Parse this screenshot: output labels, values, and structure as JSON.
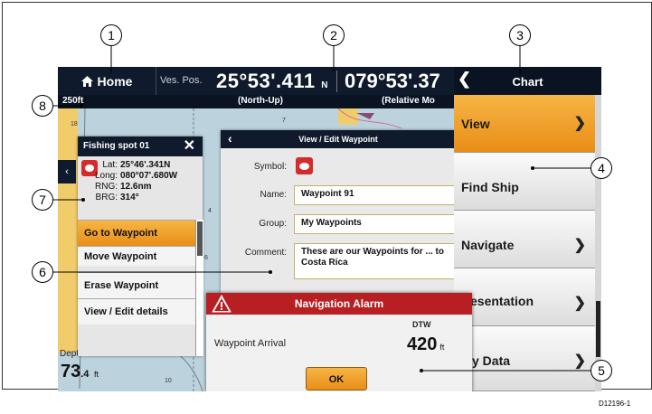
{
  "topbar": {
    "home_label": "Home",
    "vessel_pos_label": "Ves. Pos.",
    "latitude": "25°53'.411",
    "lat_hemisphere": "N",
    "longitude": "079°53'.37",
    "chart_label": "Chart"
  },
  "statusbar": {
    "range": "250ft",
    "orientation": "(North-Up)",
    "motion": "(Relative Mo"
  },
  "fishing_spot": {
    "title": "Fishing spot 01",
    "lat_label": "Lat:",
    "lat_value": "25°46'.341N",
    "long_label": "Long:",
    "long_value": "080°07'.680W",
    "rng_label": "RNG:",
    "rng_value": "12.6nm",
    "brg_label": "BRG:",
    "brg_value": "314°",
    "menu": [
      {
        "label": "Go to Waypoint"
      },
      {
        "label": "Move Waypoint"
      },
      {
        "label": "Erase Waypoint"
      },
      {
        "label": "View / Edit details"
      }
    ]
  },
  "depth": {
    "label": "Depth",
    "value_int": "73",
    "value_dec": ".4",
    "unit": "ft"
  },
  "waypoint_panel": {
    "title": "View / Edit Waypoint",
    "symbol_label": "Symbol:",
    "name_label": "Name:",
    "name_value": "Waypoint 91",
    "group_label": "Group:",
    "group_value": "My Waypoints",
    "comment_label": "Comment:",
    "comment_value": "These are our Waypoints for ... to Costa Rica"
  },
  "menu": {
    "items": [
      {
        "label": "View"
      },
      {
        "label": "Find Ship"
      },
      {
        "label": "Navigate"
      },
      {
        "label": "esentation"
      },
      {
        "label": "y Data"
      }
    ]
  },
  "alarm": {
    "title": "Navigation Alarm",
    "dtw_label": "DTW",
    "message": "Waypoint Arrival",
    "value": "420",
    "unit": "ft",
    "ok_label": "OK"
  },
  "callouts": [
    "1",
    "2",
    "3",
    "4",
    "5",
    "6",
    "7",
    "8"
  ],
  "doc_id": "D12196-1",
  "chart_depths": [
    "18",
    "7",
    "4",
    "6",
    "10"
  ],
  "colors": {
    "topbar": "#0f1b2c",
    "menu_active": "#f0a02f",
    "alarm_header": "#b81f22",
    "land": "#f1cc6a",
    "water": "#bcd3dd"
  }
}
